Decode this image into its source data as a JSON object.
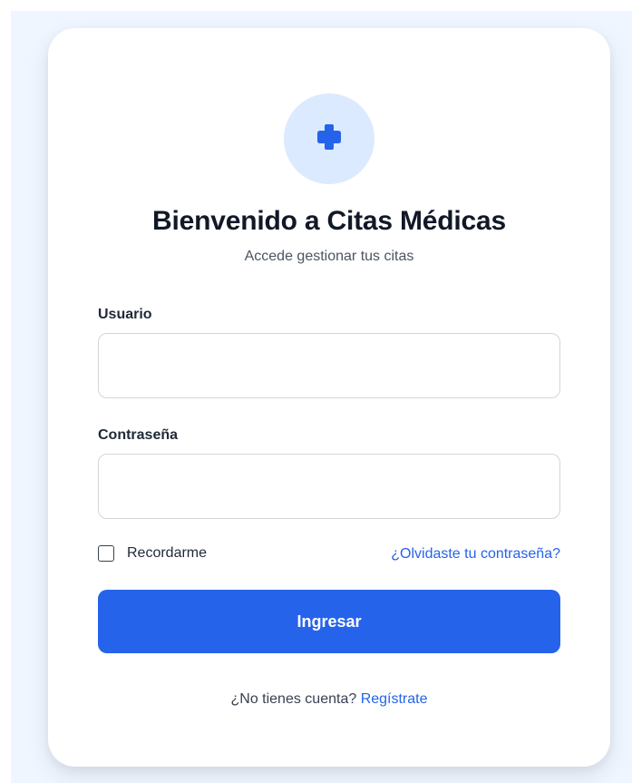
{
  "colors": {
    "page_background": "#eff6ff",
    "card_background": "#ffffff",
    "accent": "#2563eb",
    "logo_circle": "#dbeafe",
    "title_text": "#111827"
  },
  "header": {
    "logo_icon": "medical-cross-icon",
    "title": "Bienvenido a Citas Médicas",
    "subtitle": "Accede gestionar tus citas"
  },
  "form": {
    "username": {
      "label": "Usuario",
      "value": "",
      "placeholder": ""
    },
    "password": {
      "label": "Contraseña",
      "value": "",
      "placeholder": ""
    },
    "remember": {
      "label": "Recordarme",
      "checked": false
    },
    "forgot_link": "¿Olvidaste tu contraseña?",
    "submit_label": "Ingresar"
  },
  "footer": {
    "prompt": "¿No tienes cuenta?",
    "register_link": "Regístrate"
  }
}
